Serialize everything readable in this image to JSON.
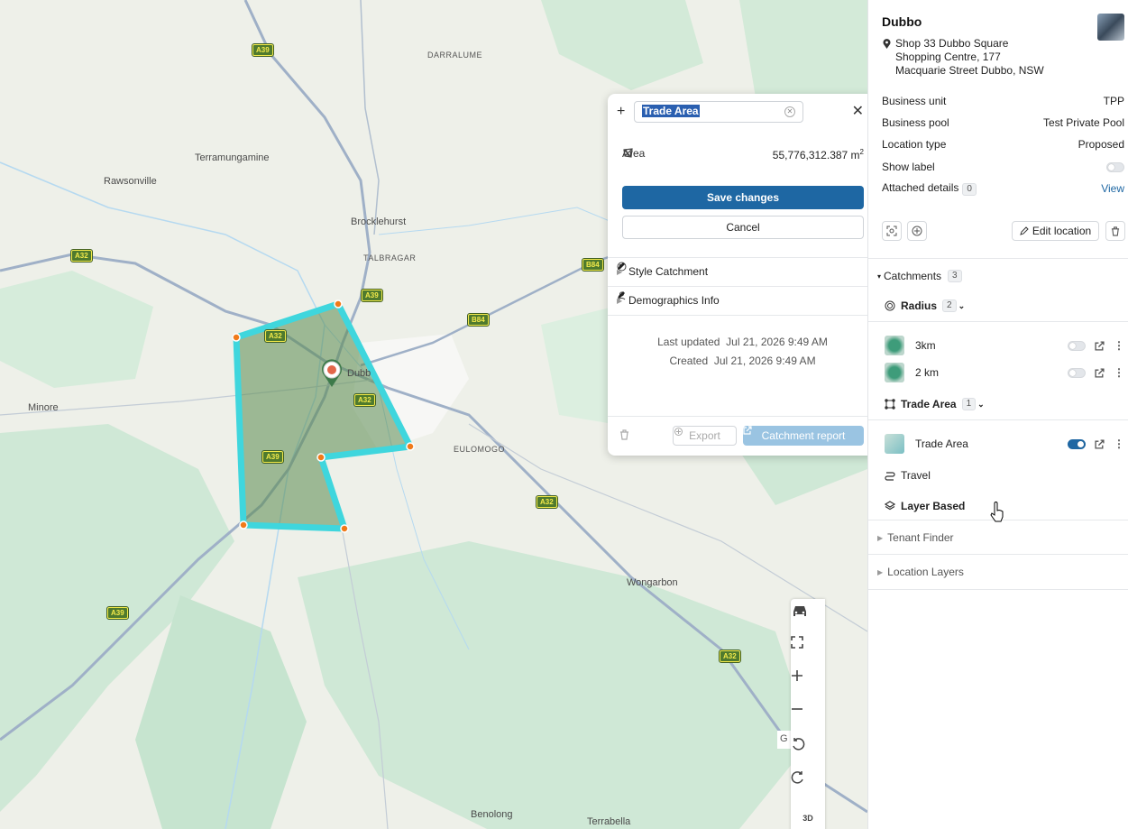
{
  "map": {
    "places": [
      {
        "name": "Terramungamine",
        "cls": ""
      },
      {
        "name": "Rawsonville",
        "cls": ""
      },
      {
        "name": "DARRALUME",
        "cls": "caps"
      },
      {
        "name": "Brocklehurst",
        "cls": ""
      },
      {
        "name": "TALBRAGAR",
        "cls": "caps"
      },
      {
        "name": "Dubb",
        "cls": ""
      },
      {
        "name": "EULOMOGO",
        "cls": "caps"
      },
      {
        "name": "Minore",
        "cls": ""
      },
      {
        "name": "Wongarbon",
        "cls": ""
      },
      {
        "name": "Benolong",
        "cls": ""
      },
      {
        "name": "Terrabella",
        "cls": ""
      }
    ],
    "shields": [
      "A39",
      "A32",
      "B84",
      "A39",
      "B84",
      "A32",
      "A32",
      "A39",
      "A32",
      "A39",
      "A32"
    ],
    "controls": [
      {
        "name": "car-icon",
        "label": "car"
      },
      {
        "name": "fullscreen-icon",
        "label": "fullscreen"
      },
      {
        "name": "zoom-in-icon",
        "label": "zoom in"
      },
      {
        "name": "zoom-out-icon",
        "label": "zoom out"
      },
      {
        "name": "rotate-left-icon",
        "label": "rotate left"
      },
      {
        "name": "rotate-right-icon",
        "label": "rotate right"
      },
      {
        "name": "3d-icon",
        "label": "3D"
      }
    ],
    "g_mark": "G"
  },
  "editor": {
    "name_value": "Trade Area",
    "area_label": "Area",
    "area_value": "55,776,312.387 m",
    "area_unit_sup": "2",
    "save_label": "Save changes",
    "cancel_label": "Cancel",
    "sections": [
      "Style Catchment",
      "Demographics Info"
    ],
    "last_updated_label": "Last updated",
    "last_updated_value": "Jul 21, 2026 9:49 AM",
    "created_label": "Created",
    "created_value": "Jul 21, 2026 9:49 AM",
    "export_label": "Export",
    "report_label": "Catchment report"
  },
  "panel": {
    "title": "Dubbo",
    "address": [
      "Shop 33 Dubbo Square",
      "Shopping Centre, 177",
      "Macquarie Street Dubbo, NSW"
    ],
    "details": [
      {
        "label": "Business unit",
        "value": "TPP"
      },
      {
        "label": "Business pool",
        "value": "Test Private Pool"
      },
      {
        "label": "Location type",
        "value": "Proposed"
      }
    ],
    "show_label": "Show label",
    "attached_label": "Attached details",
    "attached_count": "0",
    "view_label": "View",
    "edit_location_label": "Edit location",
    "catchments_label": "Catchments",
    "catchments_count": "3",
    "radius_label": "Radius",
    "radius_count": "2",
    "radius_items": [
      "3km",
      "2 km"
    ],
    "trade_area_label": "Trade Area",
    "trade_area_count": "1",
    "trade_area_items": [
      "Trade Area"
    ],
    "travel_label": "Travel",
    "layer_based_label": "Layer Based",
    "tenant_finder_label": "Tenant Finder",
    "location_layers_label": "Location Layers"
  },
  "colors": {
    "primary": "#1e67a3",
    "polygon_stroke": "#3fd6dd",
    "polygon_fill": "#5a8a4e",
    "vertex": "#f07a1a"
  }
}
